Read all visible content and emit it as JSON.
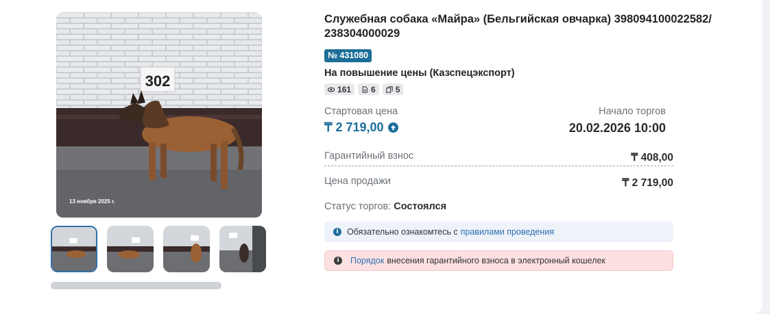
{
  "lot": {
    "title": "Служебная собака «Майра» (Бельгийская овчарка) 398094100022582/ 238304000029",
    "number_badge": "№ 431080",
    "type": "На повышение цены (Казспецэкспорт)",
    "stats": {
      "views": "161",
      "documents": "6",
      "photos": "5"
    }
  },
  "photo": {
    "date_stamp": "13 ноября 2025 г.",
    "sign_number": "302",
    "thumbnails_count": 4,
    "active_thumbnail": 1
  },
  "pricing": {
    "start_price_label": "Стартовая цена",
    "start_price": "₸ 2 719,00",
    "start_label": "Начало торгов",
    "start_date": "20.02.2026 10:00",
    "deposit_label": "Гарантийный взнос",
    "deposit": "₸ 408,00",
    "sale_price_label": "Цена продажи",
    "sale_price": "₸ 2 719,00"
  },
  "status": {
    "label": "Статус торгов:",
    "value": "Состоялся"
  },
  "notices": {
    "info_text_before": "Обязательно ознакомтесь с",
    "info_link": "правилами проведения",
    "warn_link": "Порядок",
    "warn_text_after": "внесения гарантийного взноса в электронный кошелек"
  },
  "colors": {
    "accent": "#1d6e9b",
    "badge": "#1c6e96",
    "info_bg": "#eef2f9",
    "warn_bg": "#fde0e1"
  },
  "icons": {
    "views": "eye-icon",
    "documents": "document-icon",
    "photos": "photos-icon",
    "price_up": "arrow-up-circle-icon",
    "info": "info-icon"
  }
}
